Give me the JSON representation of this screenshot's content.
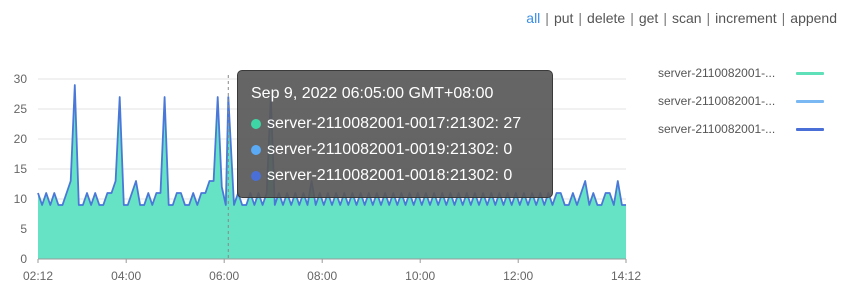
{
  "filters": {
    "items": [
      "all",
      "put",
      "delete",
      "get",
      "scan",
      "increment",
      "append"
    ],
    "active": "all"
  },
  "legend": [
    {
      "label": "server-2110082001-...",
      "color": "#5fe0b8"
    },
    {
      "label": "server-2110082001-...",
      "color": "#7ab8f4"
    },
    {
      "label": "server-2110082001-...",
      "color": "#4a6fd6"
    }
  ],
  "tooltip": {
    "time": "Sep 9, 2022 06:05:00 GMT+08:00",
    "rows": [
      {
        "text": "server-2110082001-0017:21302: 27",
        "color": "#3fd6a6"
      },
      {
        "text": "server-2110082001-0019:21302: 0",
        "color": "#5aaaf6"
      },
      {
        "text": "server-2110082001-0018:21302: 0",
        "color": "#4a6fd6"
      }
    ]
  },
  "chart_data": {
    "type": "area",
    "x_tick_labels": [
      "02:12",
      "04:00",
      "06:00",
      "08:00",
      "10:00",
      "12:00",
      "14:12"
    ],
    "y_tick_labels": [
      "0",
      "5",
      "10",
      "15",
      "20",
      "25",
      "30"
    ],
    "xlim": [
      "02:12",
      "14:12"
    ],
    "ylim": [
      0,
      30
    ],
    "grid": true,
    "legend_position": "right",
    "highlight_x": "06:05",
    "series": [
      {
        "color": "#4a78d8",
        "fill": "#66e3c4",
        "points": [
          [
            "02:12",
            11
          ],
          [
            "02:17",
            9
          ],
          [
            "02:22",
            11
          ],
          [
            "02:27",
            9
          ],
          [
            "02:32",
            11
          ],
          [
            "02:37",
            9
          ],
          [
            "02:42",
            9
          ],
          [
            "02:47",
            11
          ],
          [
            "02:52",
            13
          ],
          [
            "02:57",
            29
          ],
          [
            "03:02",
            9
          ],
          [
            "03:07",
            9
          ],
          [
            "03:12",
            11
          ],
          [
            "03:17",
            9
          ],
          [
            "03:22",
            11
          ],
          [
            "03:27",
            9
          ],
          [
            "03:32",
            9
          ],
          [
            "03:37",
            11
          ],
          [
            "03:42",
            11
          ],
          [
            "03:47",
            13
          ],
          [
            "03:52",
            27
          ],
          [
            "03:57",
            9
          ],
          [
            "04:02",
            9
          ],
          [
            "04:07",
            11
          ],
          [
            "04:12",
            13
          ],
          [
            "04:17",
            9
          ],
          [
            "04:22",
            9
          ],
          [
            "04:27",
            11
          ],
          [
            "04:32",
            9
          ],
          [
            "04:37",
            11
          ],
          [
            "04:42",
            11
          ],
          [
            "04:47",
            27
          ],
          [
            "04:52",
            9
          ],
          [
            "04:57",
            9
          ],
          [
            "05:02",
            11
          ],
          [
            "05:07",
            11
          ],
          [
            "05:12",
            9
          ],
          [
            "05:17",
            9
          ],
          [
            "05:22",
            11
          ],
          [
            "05:27",
            9
          ],
          [
            "05:32",
            11
          ],
          [
            "05:37",
            11
          ],
          [
            "05:42",
            13
          ],
          [
            "05:47",
            13
          ],
          [
            "05:52",
            27
          ],
          [
            "05:57",
            12
          ],
          [
            "06:02",
            9
          ],
          [
            "06:05",
            27
          ],
          [
            "06:12",
            9
          ],
          [
            "06:17",
            11
          ],
          [
            "06:22",
            9
          ],
          [
            "06:27",
            9
          ],
          [
            "06:32",
            11
          ],
          [
            "06:37",
            9
          ],
          [
            "06:42",
            11
          ],
          [
            "06:47",
            9
          ],
          [
            "06:52",
            11
          ],
          [
            "06:57",
            27
          ],
          [
            "07:02",
            9
          ],
          [
            "07:07",
            11
          ],
          [
            "07:12",
            9
          ],
          [
            "07:17",
            11
          ],
          [
            "07:22",
            9
          ],
          [
            "07:27",
            11
          ],
          [
            "07:32",
            9
          ],
          [
            "07:37",
            11
          ],
          [
            "07:42",
            9
          ],
          [
            "07:47",
            13
          ],
          [
            "07:52",
            9
          ],
          [
            "07:57",
            11
          ],
          [
            "08:02",
            9
          ],
          [
            "08:07",
            11
          ],
          [
            "08:12",
            9
          ],
          [
            "08:17",
            11
          ],
          [
            "08:22",
            9
          ],
          [
            "08:27",
            11
          ],
          [
            "08:32",
            9
          ],
          [
            "08:37",
            11
          ],
          [
            "08:42",
            9
          ],
          [
            "08:47",
            11
          ],
          [
            "08:52",
            9
          ],
          [
            "08:57",
            11
          ],
          [
            "09:02",
            9
          ],
          [
            "09:07",
            11
          ],
          [
            "09:12",
            9
          ],
          [
            "09:17",
            11
          ],
          [
            "09:22",
            9
          ],
          [
            "09:27",
            11
          ],
          [
            "09:32",
            9
          ],
          [
            "09:37",
            11
          ],
          [
            "09:42",
            9
          ],
          [
            "09:47",
            11
          ],
          [
            "09:52",
            9
          ],
          [
            "09:57",
            11
          ],
          [
            "10:02",
            9
          ],
          [
            "10:07",
            11
          ],
          [
            "10:12",
            9
          ],
          [
            "10:17",
            11
          ],
          [
            "10:22",
            9
          ],
          [
            "10:27",
            11
          ],
          [
            "10:32",
            9
          ],
          [
            "10:37",
            11
          ],
          [
            "10:42",
            9
          ],
          [
            "10:47",
            11
          ],
          [
            "10:52",
            9
          ],
          [
            "10:57",
            11
          ],
          [
            "11:02",
            9
          ],
          [
            "11:07",
            11
          ],
          [
            "11:12",
            9
          ],
          [
            "11:17",
            11
          ],
          [
            "11:22",
            9
          ],
          [
            "11:27",
            11
          ],
          [
            "11:32",
            9
          ],
          [
            "11:37",
            11
          ],
          [
            "11:42",
            9
          ],
          [
            "11:47",
            11
          ],
          [
            "11:52",
            9
          ],
          [
            "11:57",
            11
          ],
          [
            "12:02",
            9
          ],
          [
            "12:07",
            11
          ],
          [
            "12:12",
            9
          ],
          [
            "12:17",
            11
          ],
          [
            "12:22",
            9
          ],
          [
            "12:27",
            11
          ],
          [
            "12:32",
            9
          ],
          [
            "12:37",
            11
          ],
          [
            "12:42",
            9
          ],
          [
            "12:47",
            11
          ],
          [
            "12:52",
            11
          ],
          [
            "12:57",
            9
          ],
          [
            "13:02",
            9
          ],
          [
            "13:07",
            11
          ],
          [
            "13:12",
            9
          ],
          [
            "13:17",
            11
          ],
          [
            "13:22",
            13
          ],
          [
            "13:27",
            9
          ],
          [
            "13:32",
            11
          ],
          [
            "13:37",
            9
          ],
          [
            "13:42",
            9
          ],
          [
            "13:47",
            11
          ],
          [
            "13:52",
            11
          ],
          [
            "13:57",
            9
          ],
          [
            "14:02",
            13
          ],
          [
            "14:07",
            9
          ],
          [
            "14:12",
            9
          ]
        ]
      }
    ]
  }
}
